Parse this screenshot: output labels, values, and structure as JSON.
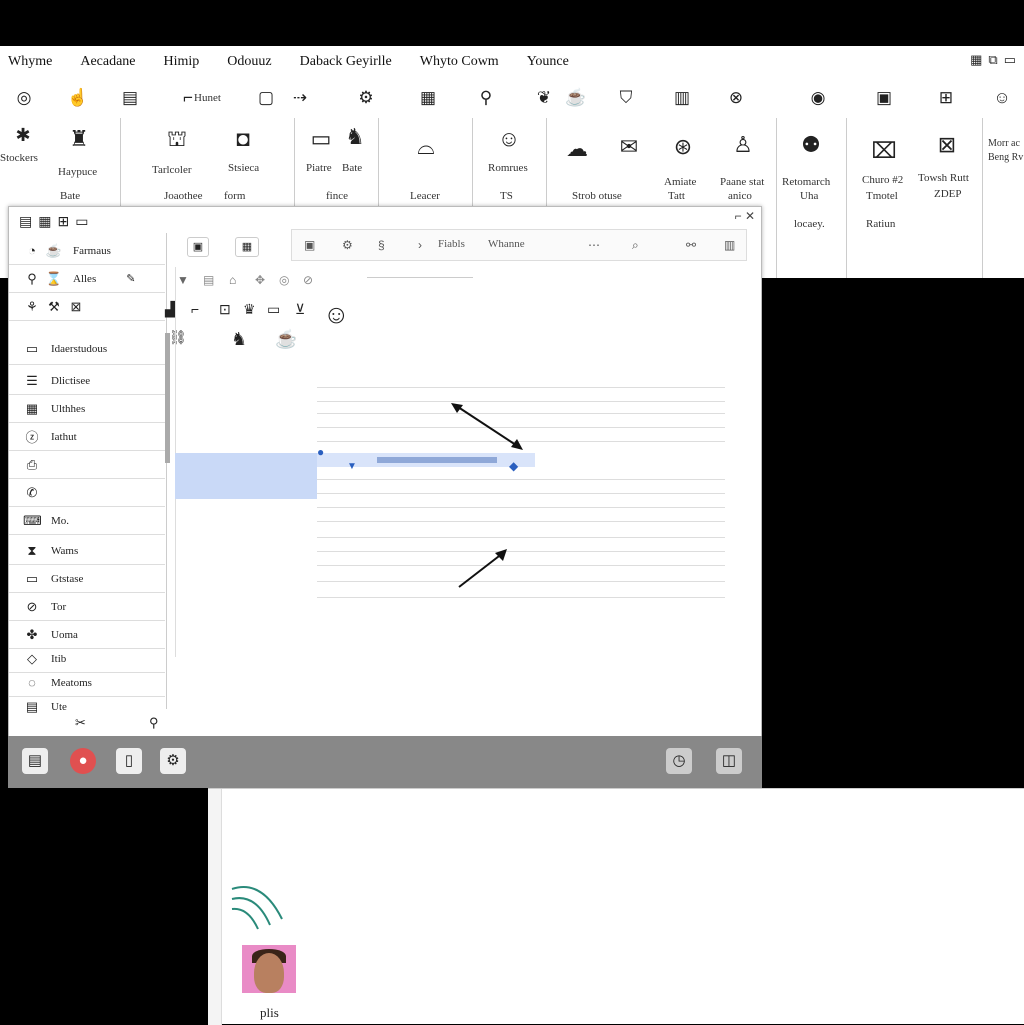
{
  "menubar": {
    "items": [
      "Whyme",
      "Aecadane",
      "Himip",
      "Odouuz",
      "Daback Geyirlle",
      "Whyto Cowm",
      "Younce"
    ]
  },
  "ribbon": {
    "small_labels": {
      "hunet": "Hunet"
    },
    "group_labels": [
      {
        "top": "Stockers",
        "bottom": ""
      },
      {
        "top": "Haypuce",
        "bottom": "Bate"
      },
      {
        "top": "Tarlcoler",
        "bottom": "Joaothee"
      },
      {
        "top": "Stsieca",
        "bottom": "form"
      },
      {
        "top": "Piatre",
        "bottom": "fince"
      },
      {
        "top": "Bate",
        "bottom": ""
      },
      {
        "top": "",
        "bottom": "Leacer"
      },
      {
        "top": "Romrues",
        "bottom": "TS"
      },
      {
        "top": "",
        "bottom": "Strob otuse"
      },
      {
        "top": "Amiate",
        "bottom": "Tatt"
      },
      {
        "top": "Paane stat",
        "bottom": "anico"
      },
      {
        "top": "Retomarch",
        "bottom": "Uha"
      },
      {
        "top": "",
        "bottom": "locaey."
      },
      {
        "top": "Churo #2",
        "bottom": "Tmotel"
      },
      {
        "top": "",
        "bottom": "Ratiun"
      },
      {
        "top": "Towsh Rutt",
        "bottom": "ZDEP"
      },
      {
        "top": "Morr ac",
        "bottom": "Beng Rv"
      }
    ]
  },
  "dialog": {
    "side_items": [
      "Farmaus",
      "Alles",
      "Idaerstudous",
      "Dlictisee",
      "Ulthhes",
      "Iathut",
      "",
      "",
      "Mo.",
      "Wams",
      "Gtstase",
      "Tor",
      "Uoma",
      "Itib",
      "Meatoms",
      "Ute"
    ],
    "toolbar": {
      "field1": "Fiabls",
      "field2": "Whanne"
    }
  },
  "lower": {
    "avatar_name": "plis"
  },
  "colors": {
    "selection": "#c9d9f7",
    "taskbar": "#888888",
    "record": "#e05050"
  }
}
